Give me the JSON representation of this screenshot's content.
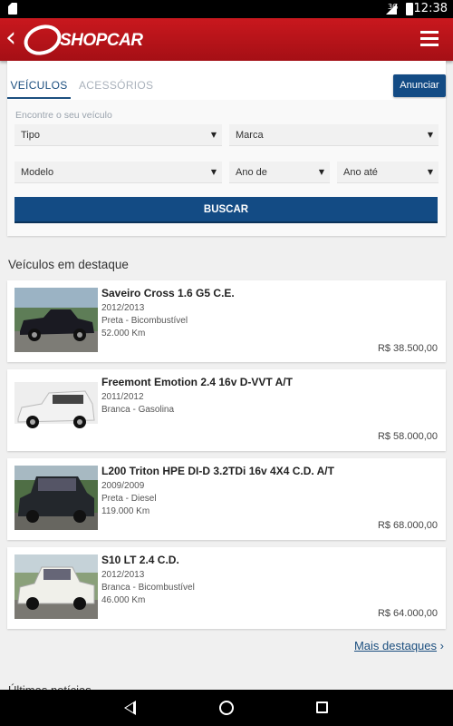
{
  "status_bar": {
    "network": "3G",
    "time": "12:38"
  },
  "app_bar": {
    "logo_text": "SHOPCAR"
  },
  "tabs": [
    {
      "label": "VEÍCULOS",
      "active": true
    },
    {
      "label": "ACESSÓRIOS",
      "active": false
    }
  ],
  "anunciar_label": "Anunciar",
  "search": {
    "hint": "Encontre o seu veículo",
    "tipo": "Tipo",
    "marca": "Marca",
    "modelo": "Modelo",
    "ano_de": "Ano de",
    "ano_ate": "Ano até",
    "buscar_label": "BUSCAR"
  },
  "featured": {
    "title": "Veículos em destaque",
    "items": [
      {
        "title": "Saveiro Cross 1.6 G5 C.E.",
        "year": "2012/2013",
        "details": "Preta - Bicombustível",
        "km": "52.000 Km",
        "price": "R$ 38.500,00",
        "color": "#1a1a22"
      },
      {
        "title": "Freemont Emotion 2.4 16v D-VVT A/T",
        "year": "2011/2012",
        "details": "Branca - Gasolina",
        "km": "",
        "price": "R$ 58.000,00",
        "color": "#f2f2f2"
      },
      {
        "title": "L200 Triton HPE DI-D 3.2TDi 16v 4X4 C.D. A/T",
        "year": "2009/2009",
        "details": "Preta - Diesel",
        "km": "119.000 Km",
        "price": "R$ 68.000,00",
        "color": "#23272c"
      },
      {
        "title": "S10 LT 2.4 C.D.",
        "year": "2012/2013",
        "details": "Branca - Bicombustível",
        "km": "46.000 Km",
        "price": "R$ 64.000,00",
        "color": "#f0f0ea"
      }
    ],
    "more_label": "Mais destaques"
  },
  "news_title": "Últimas notícias",
  "colors": {
    "brand_red": "#c9181e",
    "brand_blue": "#134b84"
  }
}
